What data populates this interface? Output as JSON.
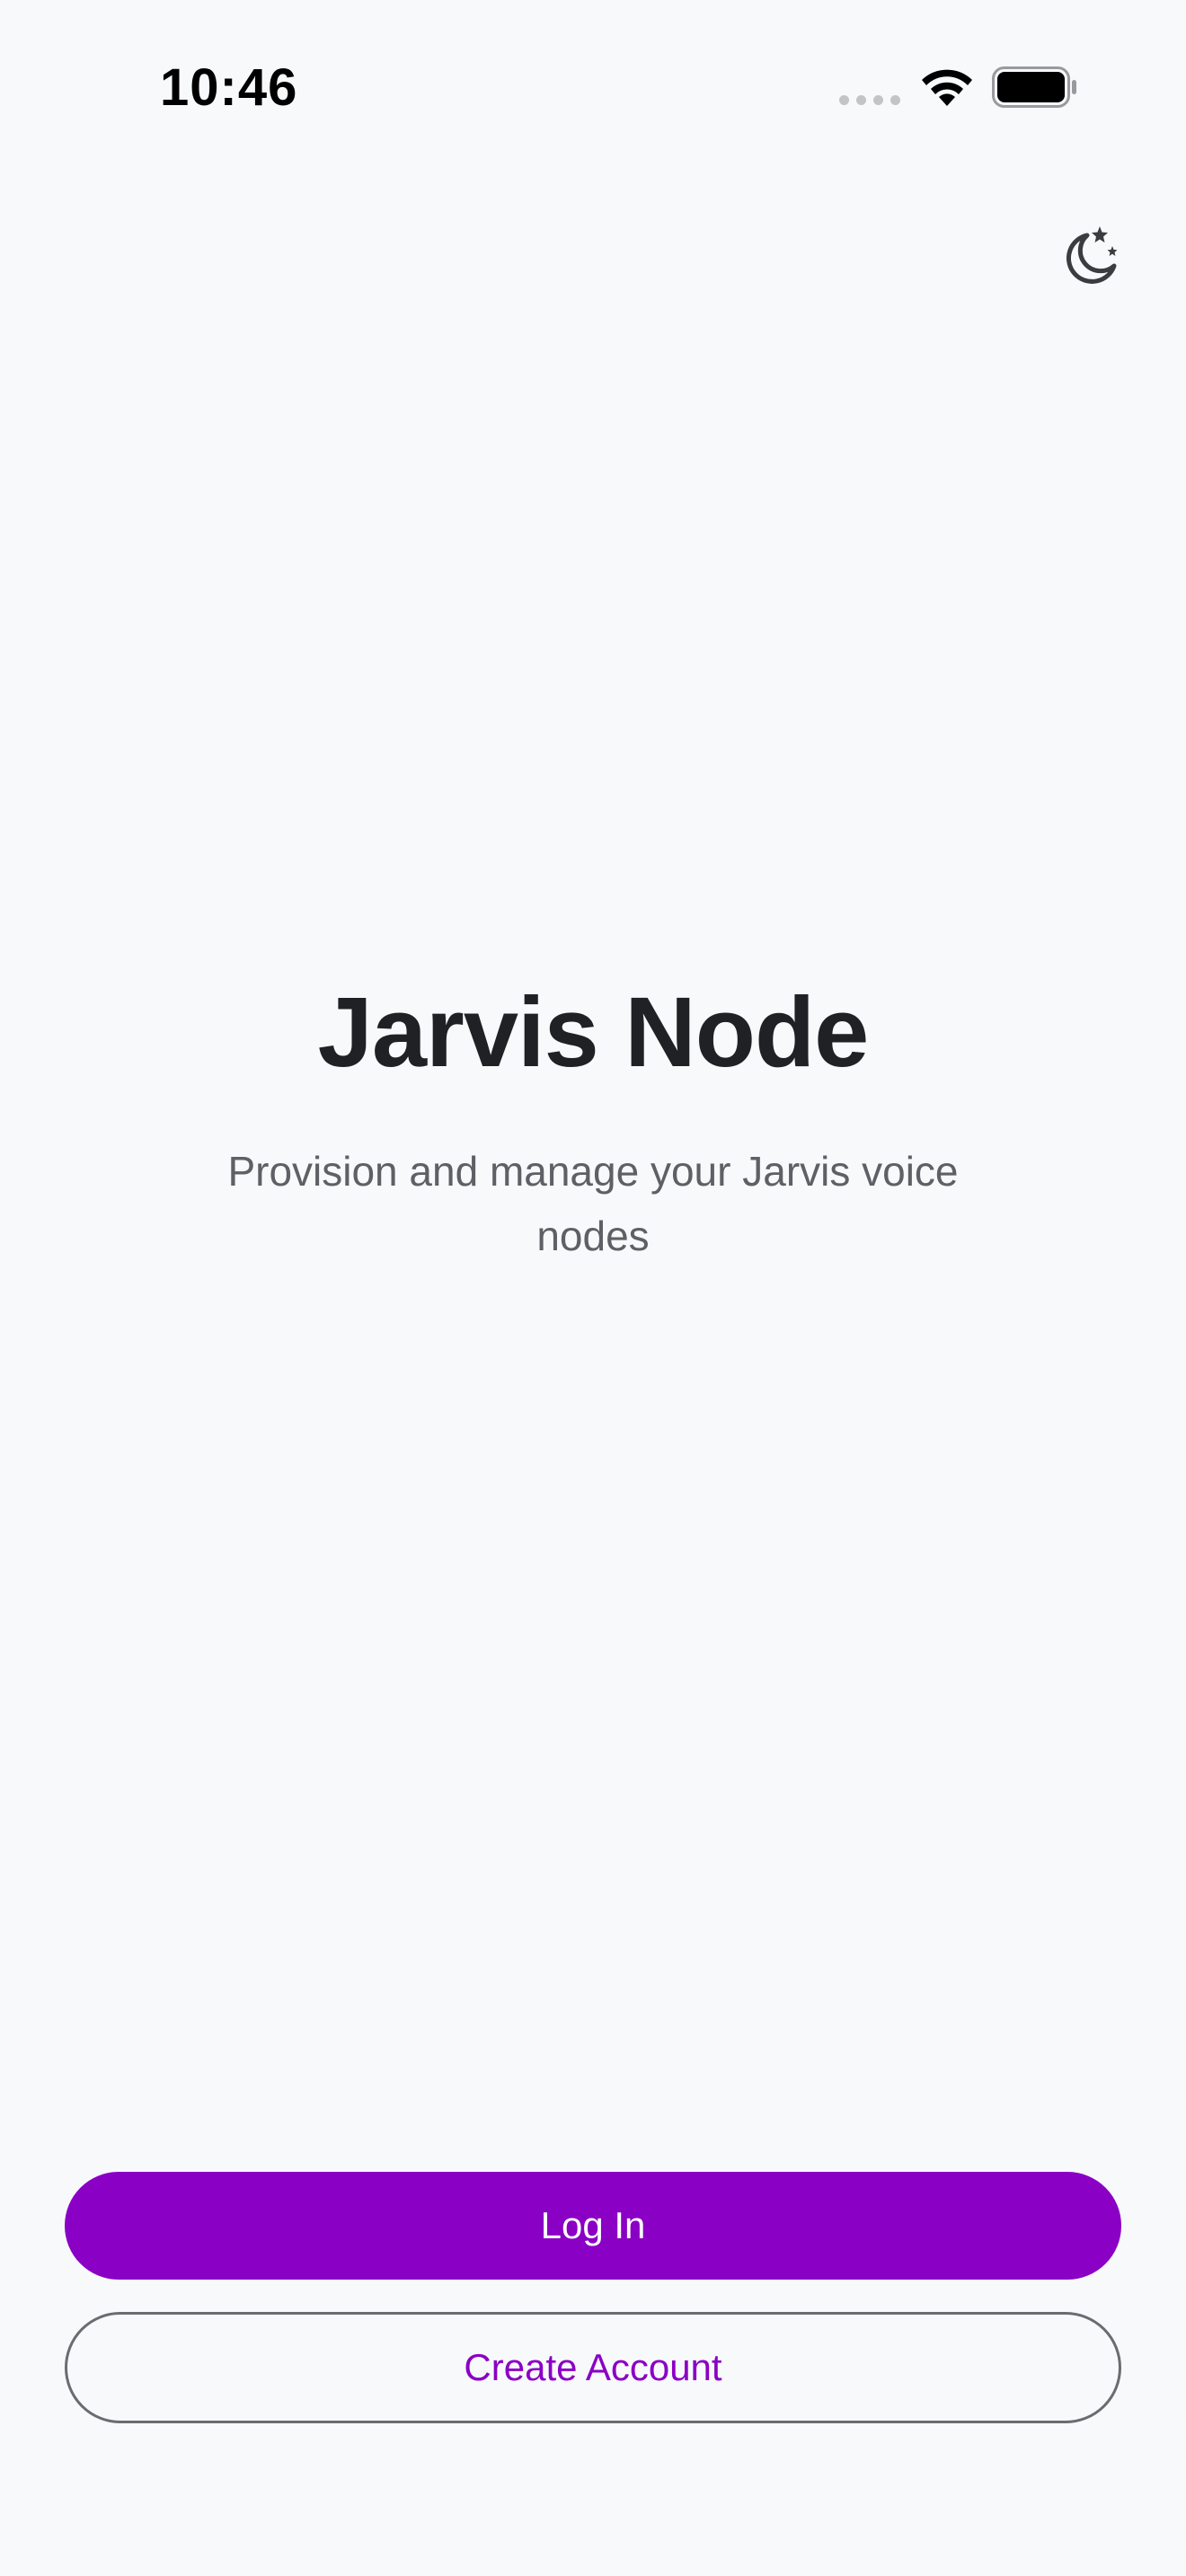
{
  "status_bar": {
    "time": "10:46"
  },
  "header": {
    "theme_toggle_icon": "moon-stars-icon"
  },
  "hero": {
    "title": "Jarvis Node",
    "subtitle": "Provision and manage your Jarvis voice nodes"
  },
  "actions": {
    "login_label": "Log In",
    "create_account_label": "Create Account"
  },
  "colors": {
    "accent": "#8a00c4",
    "background": "#f8f9fb",
    "title": "#202124",
    "subtitle": "#5f6065"
  }
}
